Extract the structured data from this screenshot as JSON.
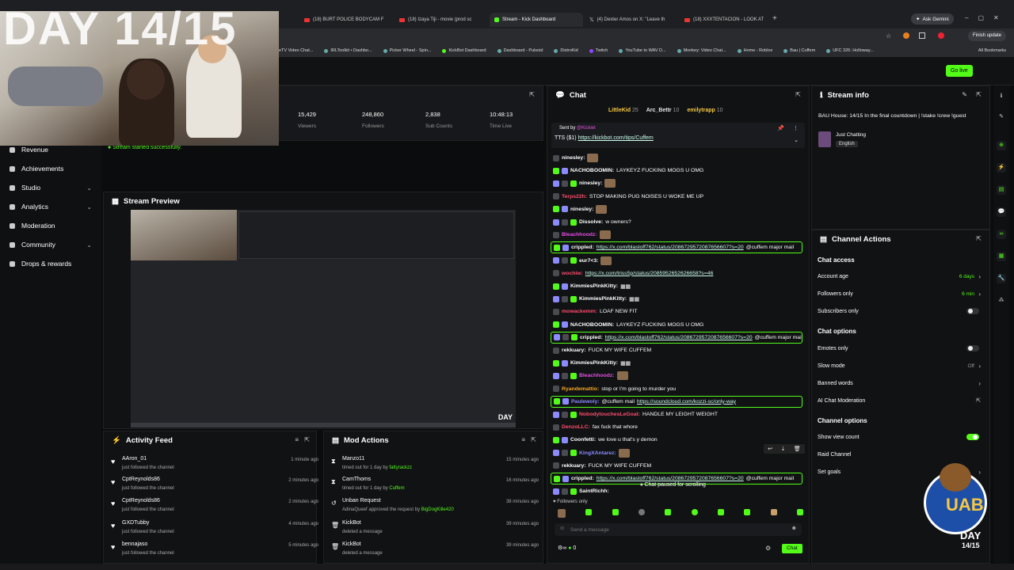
{
  "browser": {
    "tabs": [
      {
        "label": "(18) BURT POLICE BODYCAM F"
      },
      {
        "label": "(18) Izaya Tiji - movie (prod sc"
      },
      {
        "label": "Stream - Kick Dashboard"
      },
      {
        "label": "(4) Dexter Amos on X: \"Leave th"
      },
      {
        "label": "(18) XXXTENTACION - LOOK AT"
      }
    ],
    "ask_gemini": "Ask Gemini",
    "finish_update": "Finish update",
    "bookmarks": [
      "eTV Video Chat...",
      "IRLToolkit • Dashbo...",
      "Picker Wheel - Spin...",
      "KickBot Dashboard",
      "Dashboard - Pulsoid",
      "DistroKid",
      "Twitch",
      "YouTube to WAV D...",
      "Monkey: Video Chat...",
      "Home - Roblox",
      "Bau | Cuffem",
      "UFC 326: Holloway..."
    ],
    "all_bookmarks": "All Bookmarks"
  },
  "overlay_text": "DAY 14/15",
  "go_live": "Go live",
  "sidebar": {
    "items": [
      {
        "label": "Revenue",
        "chev": ""
      },
      {
        "label": "Achievements",
        "chev": ""
      },
      {
        "label": "Studio",
        "chev": "⌄"
      },
      {
        "label": "Analytics",
        "chev": "⌄"
      },
      {
        "label": "Moderation",
        "chev": ""
      },
      {
        "label": "Community",
        "chev": "⌄"
      },
      {
        "label": "Drops & rewards",
        "chev": ""
      }
    ]
  },
  "stats": [
    {
      "value": "15,429",
      "label": "Viewers"
    },
    {
      "value": "248,860",
      "label": "Followers"
    },
    {
      "value": "2,838",
      "label": "Sub Counts"
    },
    {
      "value": "10:48:13",
      "label": "Time Live"
    }
  ],
  "toast": "Stream started successfully.",
  "preview": {
    "title": "Stream Preview",
    "day_badge": "DAY"
  },
  "activity": {
    "title": "Activity Feed",
    "items": [
      {
        "name": "AAron_01",
        "sub": "just followed the channel",
        "time": "1 minute ago"
      },
      {
        "name": "CptReynolds86",
        "sub": "just followed the channel",
        "time": "2 minutes ago"
      },
      {
        "name": "CptReynolds86",
        "sub": "just followed the channel",
        "time": "2 minutes ago"
      },
      {
        "name": "GXDTubby",
        "sub": "just followed the channel",
        "time": "4 minutes ago"
      },
      {
        "name": "bennajaso",
        "sub": "just followed the channel",
        "time": "5 minutes ago"
      }
    ]
  },
  "modactions": {
    "title": "Mod Actions",
    "items": [
      {
        "icon": "⧗",
        "name": "Manzo11",
        "sub_pre": "timed out for 1 day by ",
        "sub_who": "fattyrackzz",
        "time": "15 minutes ago"
      },
      {
        "icon": "⧗",
        "name": "CamThoms",
        "sub_pre": "timed out for 1 day by ",
        "sub_who": "Cuffem",
        "time": "16 minutes ago"
      },
      {
        "icon": "↺",
        "name": "Unban Request",
        "sub_pre": "AdinaQueef approved the request by ",
        "sub_who": "BigDogKille420",
        "time": "38 minutes ago"
      },
      {
        "icon": "🗑",
        "name": "KickBot",
        "sub_pre": "deleted a message",
        "sub_who": "",
        "time": "39 minutes ago"
      },
      {
        "icon": "🗑",
        "name": "KickBot",
        "sub_pre": "deleted a message",
        "sub_who": "",
        "time": "39 minutes ago"
      }
    ]
  },
  "chat": {
    "title": "Chat",
    "top_gifters": [
      {
        "name": "LittleKid",
        "n": "25"
      },
      {
        "name": "Arc_Bettr",
        "n": "10"
      },
      {
        "name": "emilytrapp",
        "n": "10"
      }
    ],
    "pinned_sender": "@Kickiet",
    "pinned_prefix": "Sent by",
    "pinned_tts": "TTS ($1)",
    "pinned_link": "https://kickbot.com/tips/Cuffem",
    "messages": [
      {
        "user": "ninesley:",
        "color": "#ffffff",
        "text": "",
        "link": "",
        "emote": true,
        "hl": false
      },
      {
        "user": "NACHOBOOMIN:",
        "color": "#ffffff",
        "text": "LAYKEYZ FUCKING MOGS U OMG",
        "link": "",
        "emote": false,
        "hl": false
      },
      {
        "user": "ninesley:",
        "color": "#ffffff",
        "text": "",
        "link": "",
        "emote": true,
        "hl": false
      },
      {
        "user": "Terps22h:",
        "color": "#ff4d6d",
        "text": "STOP MAKING PUG NOISES U WOKE ME UP",
        "link": "",
        "emote": false,
        "hl": false
      },
      {
        "user": "ninesley:",
        "color": "#ffffff",
        "text": "",
        "link": "",
        "emote": true,
        "hl": false
      },
      {
        "user": "Dissolve:",
        "color": "#ffffff",
        "text": "w owners?",
        "link": "",
        "emote": false,
        "hl": false
      },
      {
        "user": "Bleachhoodz:",
        "color": "#e34fe3",
        "text": "",
        "link": "",
        "emote": true,
        "hl": false
      },
      {
        "user": "crippled:",
        "color": "#ffffff",
        "text": " @cuffem major mail",
        "link": "https://x.com/blastoff762/status/2086729572087656607?s=20",
        "emote": false,
        "hl": true
      },
      {
        "user": "eur7<3:",
        "color": "#ffffff",
        "text": "",
        "link": "",
        "emote": true,
        "hl": false
      },
      {
        "user": "wochiw:",
        "color": "#ff4d6d",
        "text": "",
        "link": "https://x.com/triss5p/status/2085952652626658?s=46",
        "emote": false,
        "hl": false
      },
      {
        "user": "KimmiesPinkKitty:",
        "color": "#ffffff",
        "text": "▦▦",
        "link": "",
        "emote": false,
        "hl": false
      },
      {
        "user": "KimmiesPinkKitty:",
        "color": "#ffffff",
        "text": "▦▦",
        "link": "",
        "emote": false,
        "hl": false
      },
      {
        "user": "mowackemm:",
        "color": "#ff4d6d",
        "text": "LOAF NEW FIT",
        "link": "",
        "emote": false,
        "hl": false
      },
      {
        "user": "NACHOBOOMIN:",
        "color": "#ffffff",
        "text": "LAYKEYZ FUCKING MOGS U OMG",
        "link": "",
        "emote": false,
        "hl": false
      },
      {
        "user": "crippled:",
        "color": "#ffffff",
        "text": " @cuffem major mail",
        "link": "https://x.com/blastoff762/status/2086729572087656607?s=20",
        "emote": false,
        "hl": true
      },
      {
        "user": "rekkuary:",
        "color": "#ffffff",
        "text": "FUCK MY WIFE CUFFEM",
        "link": "",
        "emote": false,
        "hl": false
      },
      {
        "user": "KimmiesPinkKitty:",
        "color": "#ffffff",
        "text": "▦▦",
        "link": "",
        "emote": false,
        "hl": false
      },
      {
        "user": "Bleachhoodz:",
        "color": "#e34fe3",
        "text": "",
        "link": "",
        "emote": true,
        "hl": false
      },
      {
        "user": "Ryandemattio:",
        "color": "#f5a623",
        "text": "stop or I'm going to murder you",
        "link": "",
        "emote": false,
        "hl": false
      },
      {
        "user": "Paulewoly:",
        "color": "#8b8bff",
        "text": "@cuffem mail ",
        "link": "https://soundcloud.com/kozzi-sc/only-way",
        "emote": false,
        "hl": true
      },
      {
        "user": "NobodytouchesLeGoat:",
        "color": "#ff4d6d",
        "text": "HANDLE MY LEIGHT WEIGHT",
        "link": "",
        "emote": false,
        "hl": false
      },
      {
        "user": "DenzoLLC:",
        "color": "#ff4d6d",
        "text": "fax fuck that whore",
        "link": "",
        "emote": false,
        "hl": false
      },
      {
        "user": "Coonfetti:",
        "color": "#ffffff",
        "text": "we love u that's y demon",
        "link": "",
        "emote": false,
        "hl": false
      },
      {
        "user": "KingXAntarez:",
        "color": "#8b8bff",
        "text": "",
        "link": "",
        "emote": true,
        "hl": false
      },
      {
        "user": "rekkuary:",
        "color": "#ffffff",
        "text": "FUCK MY WIFE CUFFEM",
        "link": "",
        "emote": false,
        "hl": false
      },
      {
        "user": "crippled:",
        "color": "#ffffff",
        "text": " @cuffem major mail",
        "link": "https://x.com/blastoff762/status/2086729572087656607?s=20",
        "emote": false,
        "hl": true
      },
      {
        "user": "SaintRichh:",
        "color": "#ffffff",
        "text": "",
        "link": "",
        "emote": false,
        "hl": false
      }
    ],
    "paused": "Chat paused for scrolling",
    "followers_only": "Followers only",
    "placeholder": "Send a message",
    "points": "0",
    "send": "Chat"
  },
  "streaminfo": {
    "title": "Stream info",
    "stream_title": "BAU House: 14/15 In the final countdown | !stake !crew !guest",
    "category": "Just Chatting",
    "language": "English"
  },
  "chanactions": {
    "title": "Channel Actions",
    "sec_access": "Chat access",
    "account_age": {
      "label": "Account age",
      "value": "6 days"
    },
    "followers_only": {
      "label": "Followers only",
      "value": "6 min"
    },
    "subscribers_only": {
      "label": "Subscribers only"
    },
    "sec_options": "Chat options",
    "emotes_only": {
      "label": "Emotes only"
    },
    "slow_mode": {
      "label": "Slow mode",
      "value": "Off"
    },
    "banned_words": {
      "label": "Banned words"
    },
    "ai_mod": {
      "label": "AI Chat Moderation"
    },
    "sec_channel": "Channel options",
    "show_view_count": {
      "label": "Show view count"
    },
    "raid_channel": {
      "label": "Raid Channel"
    },
    "set_goals": {
      "label": "Set goals"
    }
  },
  "mascot": {
    "letters": "UAB",
    "day": "DAY",
    "frac": "14/15"
  },
  "colors": {
    "accent": "#53fc18",
    "bg": "#0b0c0e",
    "panel": "#17181b"
  }
}
